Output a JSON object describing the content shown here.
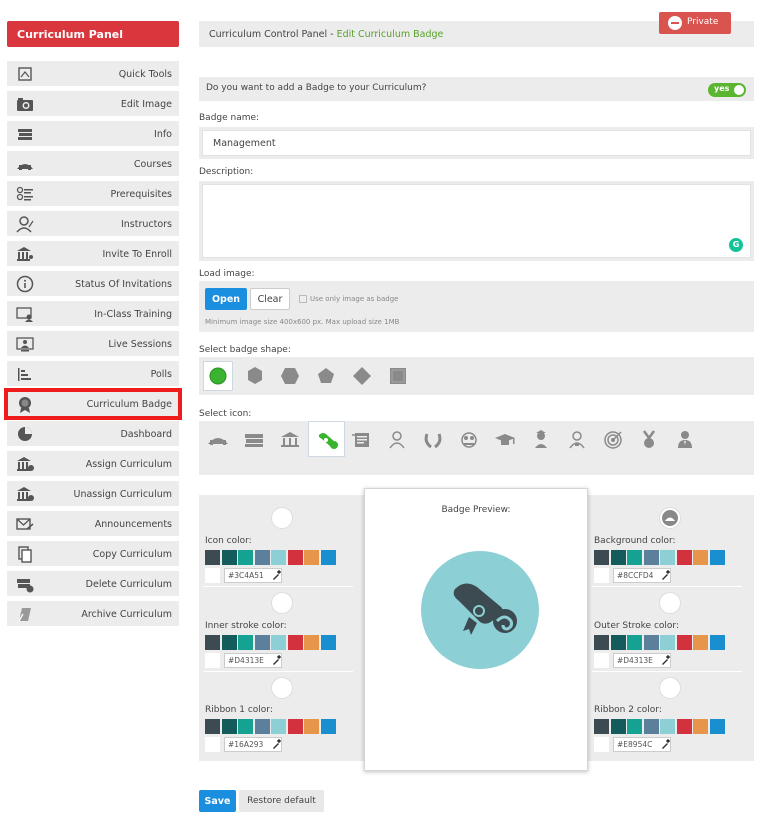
{
  "sidebar": {
    "title": "Curriculum Panel",
    "items": [
      {
        "label": "Quick Tools",
        "icon": "quick-tools-icon"
      },
      {
        "label": "Edit Image",
        "icon": "camera-icon"
      },
      {
        "label": "Info",
        "icon": "books-icon"
      },
      {
        "label": "Courses",
        "icon": "book-open-icon"
      },
      {
        "label": "Prerequisites",
        "icon": "checklist-icon"
      },
      {
        "label": "Instructors",
        "icon": "instructor-icon"
      },
      {
        "label": "Invite To Enroll",
        "icon": "institution-user-icon"
      },
      {
        "label": "Status Of Invitations",
        "icon": "info-circle-icon"
      },
      {
        "label": "In-Class Training",
        "icon": "classroom-icon"
      },
      {
        "label": "Live Sessions",
        "icon": "monitor-user-icon"
      },
      {
        "label": "Polls",
        "icon": "bar-chart-icon"
      },
      {
        "label": "Curriculum Badge",
        "icon": "badge-icon"
      },
      {
        "label": "Dashboard",
        "icon": "pie-chart-icon"
      },
      {
        "label": "Assign Curriculum",
        "icon": "institution-add-icon"
      },
      {
        "label": "Unassign Curriculum",
        "icon": "institution-remove-icon"
      },
      {
        "label": "Announcements",
        "icon": "envelope-send-icon"
      },
      {
        "label": "Copy Curriculum",
        "icon": "copy-icon"
      },
      {
        "label": "Delete Curriculum",
        "icon": "delete-book-icon"
      },
      {
        "label": "Archive Curriculum",
        "icon": "archive-icon"
      }
    ]
  },
  "header": {
    "crumb_prefix": "Curriculum Control Panel - ",
    "crumb_link": "Edit Curriculum Badge",
    "private_label": "Private"
  },
  "form": {
    "add_badge_question": "Do you want to add a Badge to your Curriculum?",
    "toggle_label": "yes",
    "badge_name_label": "Badge name:",
    "badge_name_value": "Management",
    "description_label": "Description:",
    "description_value": "",
    "load_image_label": "Load image:",
    "open_label": "Open",
    "clear_label": "Clear",
    "only_image_label": "Use only image as badge",
    "image_hint": "Minimum image size 400x600 px. Max upload size 1MB",
    "shape_label": "Select badge shape:",
    "icon_label": "Select icon:"
  },
  "colors": {
    "preview_title": "Badge Preview:",
    "palette": [
      "#3c4a51",
      "#145c5c",
      "#16a293",
      "#5c7f9c",
      "#8ccfd4",
      "#d4313e",
      "#e8954c",
      "#1a8fcf",
      "#eeeeee"
    ],
    "icon_color_label": "Icon color:",
    "icon_color": "#3C4A51",
    "inner_stroke_label": "Inner stroke color:",
    "inner_stroke": "#D4313E",
    "ribbon1_label": "Ribbon 1 color:",
    "ribbon1": "#16A293",
    "background_label": "Background color:",
    "background": "#8CCFD4",
    "outer_stroke_label": "Outer Stroke color:",
    "outer_stroke": "#D4313E",
    "ribbon2_label": "Ribbon 2 color:",
    "ribbon2": "#E8954C"
  },
  "actions": {
    "save_label": "Save",
    "restore_label": "Restore default"
  }
}
